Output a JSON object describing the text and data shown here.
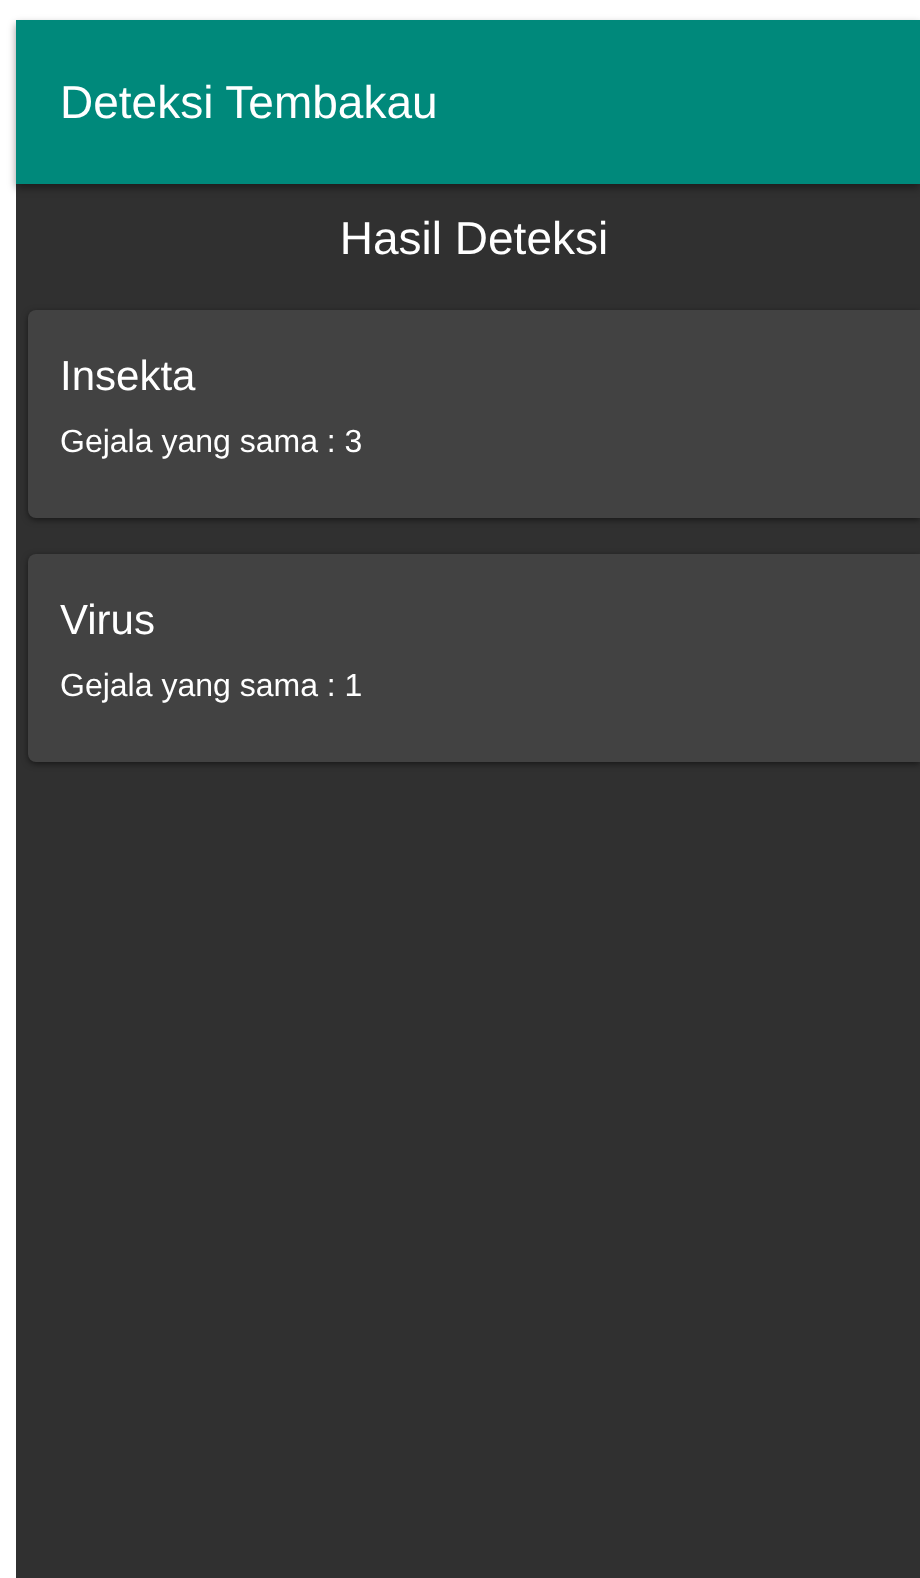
{
  "app_bar": {
    "title": "Deteksi Tembakau"
  },
  "heading": "Hasil Deteksi",
  "results": [
    {
      "name": "Insekta",
      "detail": "Gejala yang sama : 3"
    },
    {
      "name": "Virus",
      "detail": "Gejala yang sama : 1"
    }
  ]
}
